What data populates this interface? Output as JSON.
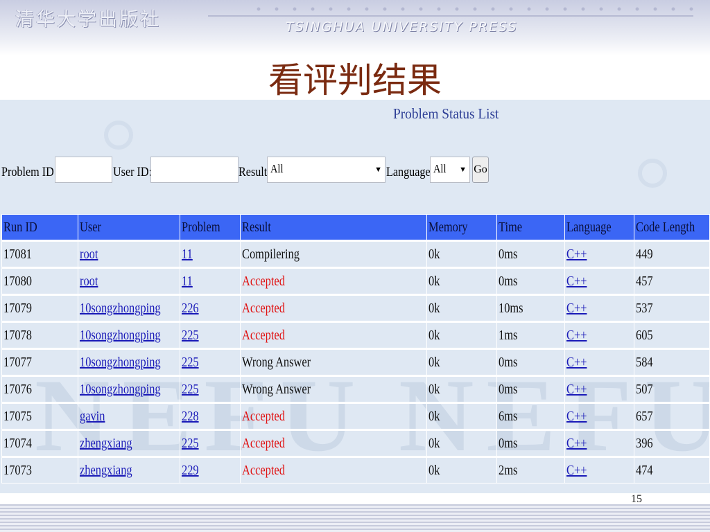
{
  "slide": {
    "publisher_cn": "清华大学出版社",
    "publisher_en": "TSINGHUA UNIVERSITY PRESS",
    "title": "看评判结果",
    "page_number": "15"
  },
  "panel": {
    "title": "Problem Status List",
    "watermark": "NEFU"
  },
  "filter": {
    "problem_id_label": "Problem ID:",
    "problem_id_value": "",
    "user_id_label": "User ID:",
    "user_id_value": "",
    "result_label": "Result:",
    "result_value": "All",
    "language_label": "Language:",
    "language_value": "All",
    "go_label": "Go"
  },
  "table": {
    "columns": [
      "Run ID",
      "User",
      "Problem",
      "Result",
      "Memory",
      "Time",
      "Language",
      "Code Length"
    ],
    "rows": [
      {
        "run_id": "17081",
        "user": "root",
        "problem": "11",
        "result": "Compilering",
        "accepted": false,
        "memory": "0k",
        "time": "0ms",
        "language": "C++",
        "code_length": "449"
      },
      {
        "run_id": "17080",
        "user": "root",
        "problem": "11",
        "result": "Accepted",
        "accepted": true,
        "memory": "0k",
        "time": "0ms",
        "language": "C++",
        "code_length": "457"
      },
      {
        "run_id": "17079",
        "user": "10songzhongping",
        "problem": "226",
        "result": "Accepted",
        "accepted": true,
        "memory": "0k",
        "time": "10ms",
        "language": "C++",
        "code_length": "537"
      },
      {
        "run_id": "17078",
        "user": "10songzhongping",
        "problem": "225",
        "result": "Accepted",
        "accepted": true,
        "memory": "0k",
        "time": "1ms",
        "language": "C++",
        "code_length": "605"
      },
      {
        "run_id": "17077",
        "user": "10songzhongping",
        "problem": "225",
        "result": "Wrong Answer",
        "accepted": false,
        "memory": "0k",
        "time": "0ms",
        "language": "C++",
        "code_length": "584"
      },
      {
        "run_id": "17076",
        "user": "10songzhongping",
        "problem": "225",
        "result": "Wrong Answer",
        "accepted": false,
        "memory": "0k",
        "time": "0ms",
        "language": "C++",
        "code_length": "507"
      },
      {
        "run_id": "17075",
        "user": "gavin",
        "problem": "228",
        "result": "Accepted",
        "accepted": true,
        "memory": "0k",
        "time": "6ms",
        "language": "C++",
        "code_length": "657"
      },
      {
        "run_id": "17074",
        "user": "zhengxiang",
        "problem": "225",
        "result": "Accepted",
        "accepted": true,
        "memory": "0k",
        "time": "0ms",
        "language": "C++",
        "code_length": "396"
      },
      {
        "run_id": "17073",
        "user": "zhengxiang",
        "problem": "229",
        "result": "Accepted",
        "accepted": true,
        "memory": "0k",
        "time": "2ms",
        "language": "C++",
        "code_length": "474"
      }
    ]
  },
  "colors": {
    "header_bg": "#3b66f5",
    "accepted": "#e01010",
    "link": "#1a1ab8",
    "title": "#7a2a10"
  }
}
